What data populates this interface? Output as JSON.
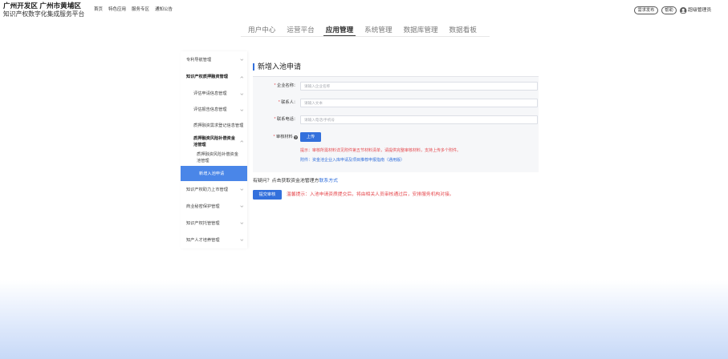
{
  "header": {
    "title": "广州开发区 广州市黄埔区",
    "subtitle": "知识产权数字化集成服务平台",
    "nav": [
      {
        "label": "首页"
      },
      {
        "label": "特色应用"
      },
      {
        "label": "服务专区"
      },
      {
        "label": "通知公告"
      }
    ],
    "actions": {
      "demand_label": "需求发布",
      "help_label": "帮助",
      "avatar_icon": "user-avatar-icon",
      "user_name": "超级管理员"
    }
  },
  "tabs": [
    {
      "label": "用户中心",
      "active": false
    },
    {
      "label": "运营平台",
      "active": false
    },
    {
      "label": "应用管理",
      "active": true
    },
    {
      "label": "系统管理",
      "active": false
    },
    {
      "label": "数据库管理",
      "active": false
    },
    {
      "label": "数据看板",
      "active": false
    }
  ],
  "sidebar": {
    "items": [
      {
        "label": "专利导航管理",
        "icon": "chevron-down-icon",
        "expanded": false
      },
      {
        "label": "知识产权质押融资管理",
        "icon": "chevron-up-icon",
        "expanded": true,
        "children": [
          {
            "label": "评估申请信息管理",
            "icon": "chevron-down-icon"
          },
          {
            "label": "评估报告信息管理",
            "icon": "chevron-down-icon"
          },
          {
            "label": "质押融资需求登记信息管理"
          },
          {
            "label": "质押融资风险补偿资金池管理",
            "icon": "chevron-up-icon",
            "expanded": true,
            "children": [
              {
                "label": "质押融资风险补偿资金池管理",
                "active": false
              },
              {
                "label": "新增入池申请",
                "active": true
              }
            ]
          }
        ]
      },
      {
        "label": "知识产权助力上市管理",
        "icon": "chevron-down-icon",
        "expanded": false
      },
      {
        "label": "商业秘密保护管理",
        "icon": "chevron-down-icon",
        "expanded": false
      },
      {
        "label": "知识产权托管管理",
        "icon": "chevron-down-icon",
        "expanded": false
      },
      {
        "label": "知产人才培养管理",
        "icon": "chevron-down-icon",
        "expanded": false
      }
    ]
  },
  "page": {
    "title": "新增入池申请"
  },
  "form": {
    "required_mark": "*",
    "fields": [
      {
        "label": "企业名称：",
        "placeholder": "请输入企业名称",
        "value": ""
      },
      {
        "label": "联系人：",
        "placeholder": "请输入文本",
        "value": ""
      },
      {
        "label": "联系电话：",
        "placeholder": "请输入电话/手机号",
        "value": ""
      }
    ],
    "materials": {
      "label": "审核材料",
      "help_icon": "question-circle-icon",
      "upload_label": "上传",
      "tip": "提示：审核所需材料详见附件第五节材料清单，请提供完整审核材料，支持上传多个附件。",
      "attachment_prefix": "附件：",
      "attachment_link": "资金池企业入库申请及项目推荐申报指南（通用版）"
    },
    "contact": {
      "text": "有疑问？点击获取资金池管理方",
      "link": "联系方式"
    },
    "submit_label": "提交审核",
    "notice": "温馨提示：入池申请资质提交后，将由相关人员审核通过后，安排服务机构对接。"
  },
  "colors": {
    "primary": "#3370dc",
    "active_menu": "#4a86e8",
    "danger": "#e5484d",
    "form_bg": "#f6f7f9"
  }
}
